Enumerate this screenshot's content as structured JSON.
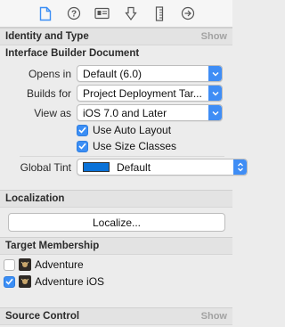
{
  "toolbar": {
    "icons": [
      "file-inspector-icon",
      "quick-help-icon",
      "identity-icon",
      "attributes-icon",
      "size-icon",
      "connections-icon"
    ],
    "accent": "#3b8ef5"
  },
  "identity_and_type": {
    "title": "Identity and Type",
    "show": "Show"
  },
  "ib_document": {
    "title": "Interface Builder Document",
    "opens_in_label": "Opens in",
    "opens_in_value": "Default (6.0)",
    "builds_for_label": "Builds for",
    "builds_for_value": "Project Deployment Tar...",
    "view_as_label": "View as",
    "view_as_value": "iOS 7.0 and Later",
    "use_auto_layout": {
      "label": "Use Auto Layout",
      "checked": true
    },
    "use_size_classes": {
      "label": "Use Size Classes",
      "checked": true
    },
    "global_tint_label": "Global Tint",
    "global_tint_value": "Default",
    "global_tint_color": "#0a72d8"
  },
  "localization": {
    "title": "Localization",
    "button": "Localize..."
  },
  "target_membership": {
    "title": "Target Membership",
    "targets": [
      {
        "name": "Adventure",
        "checked": false
      },
      {
        "name": "Adventure iOS",
        "checked": true
      }
    ]
  },
  "source_control": {
    "title": "Source Control",
    "show": "Show"
  }
}
